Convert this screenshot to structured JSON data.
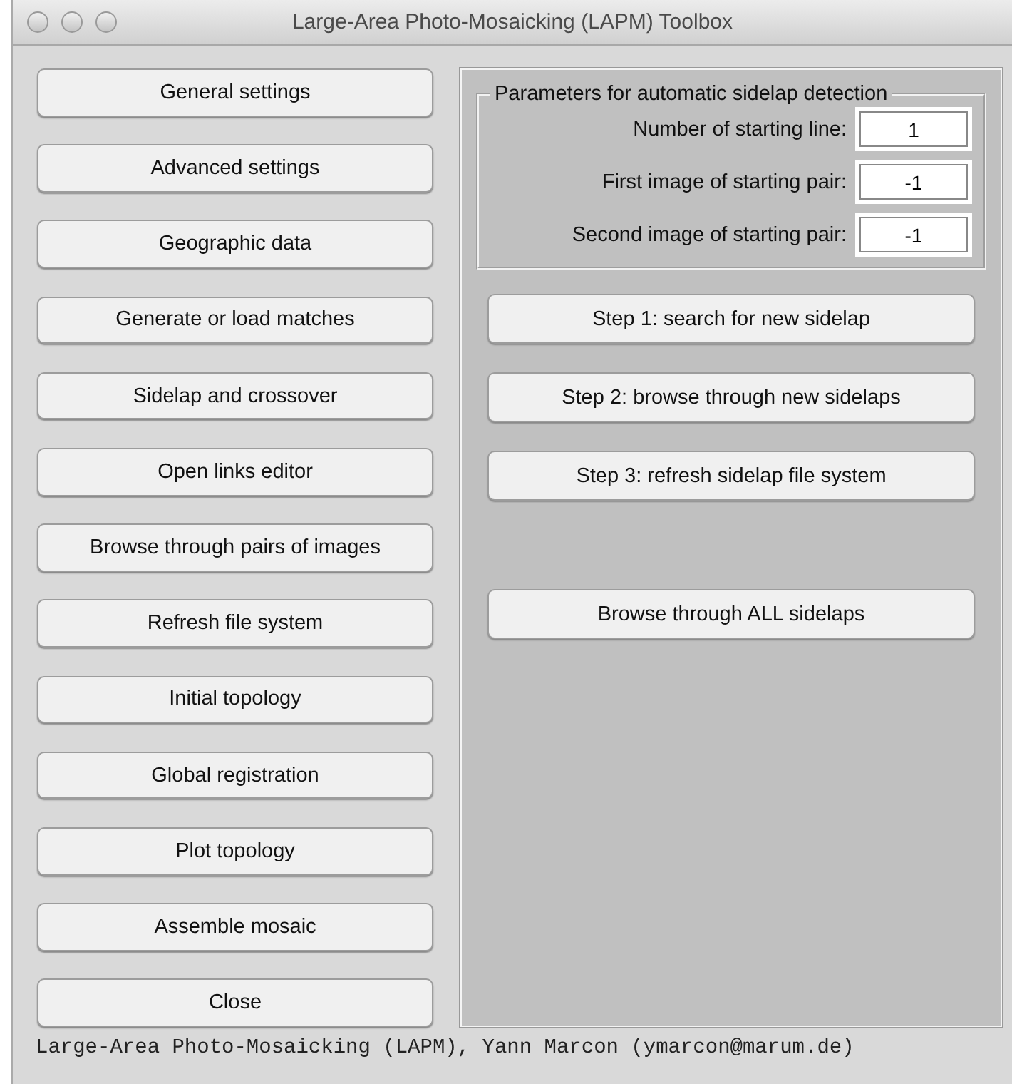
{
  "window": {
    "title": "Large-Area Photo-Mosaicking (LAPM) Toolbox"
  },
  "menu_buttons": [
    "General settings",
    "Advanced settings",
    "Geographic data",
    "Generate or load matches",
    "Sidelap and crossover",
    "Open links editor",
    "Browse through pairs of images",
    "Refresh file system",
    "Initial topology",
    "Global registration",
    "Plot topology",
    "Assemble mosaic",
    "Close"
  ],
  "parameters": {
    "title": "Parameters for automatic sidelap detection",
    "fields": [
      {
        "label": "Number of starting line:",
        "value": "1"
      },
      {
        "label": "First image of starting pair:",
        "value": "-1"
      },
      {
        "label": "Second image of starting pair:",
        "value": "-1"
      }
    ]
  },
  "step_buttons": [
    "Step 1: search for new sidelap",
    "Step 2: browse through new sidelaps",
    "Step 3: refresh sidelap file system"
  ],
  "browse_all_button": "Browse through ALL sidelaps",
  "status_bar": "Large-Area Photo-Mosaicking (LAPM), Yann Marcon (ymarcon@marum.de)"
}
